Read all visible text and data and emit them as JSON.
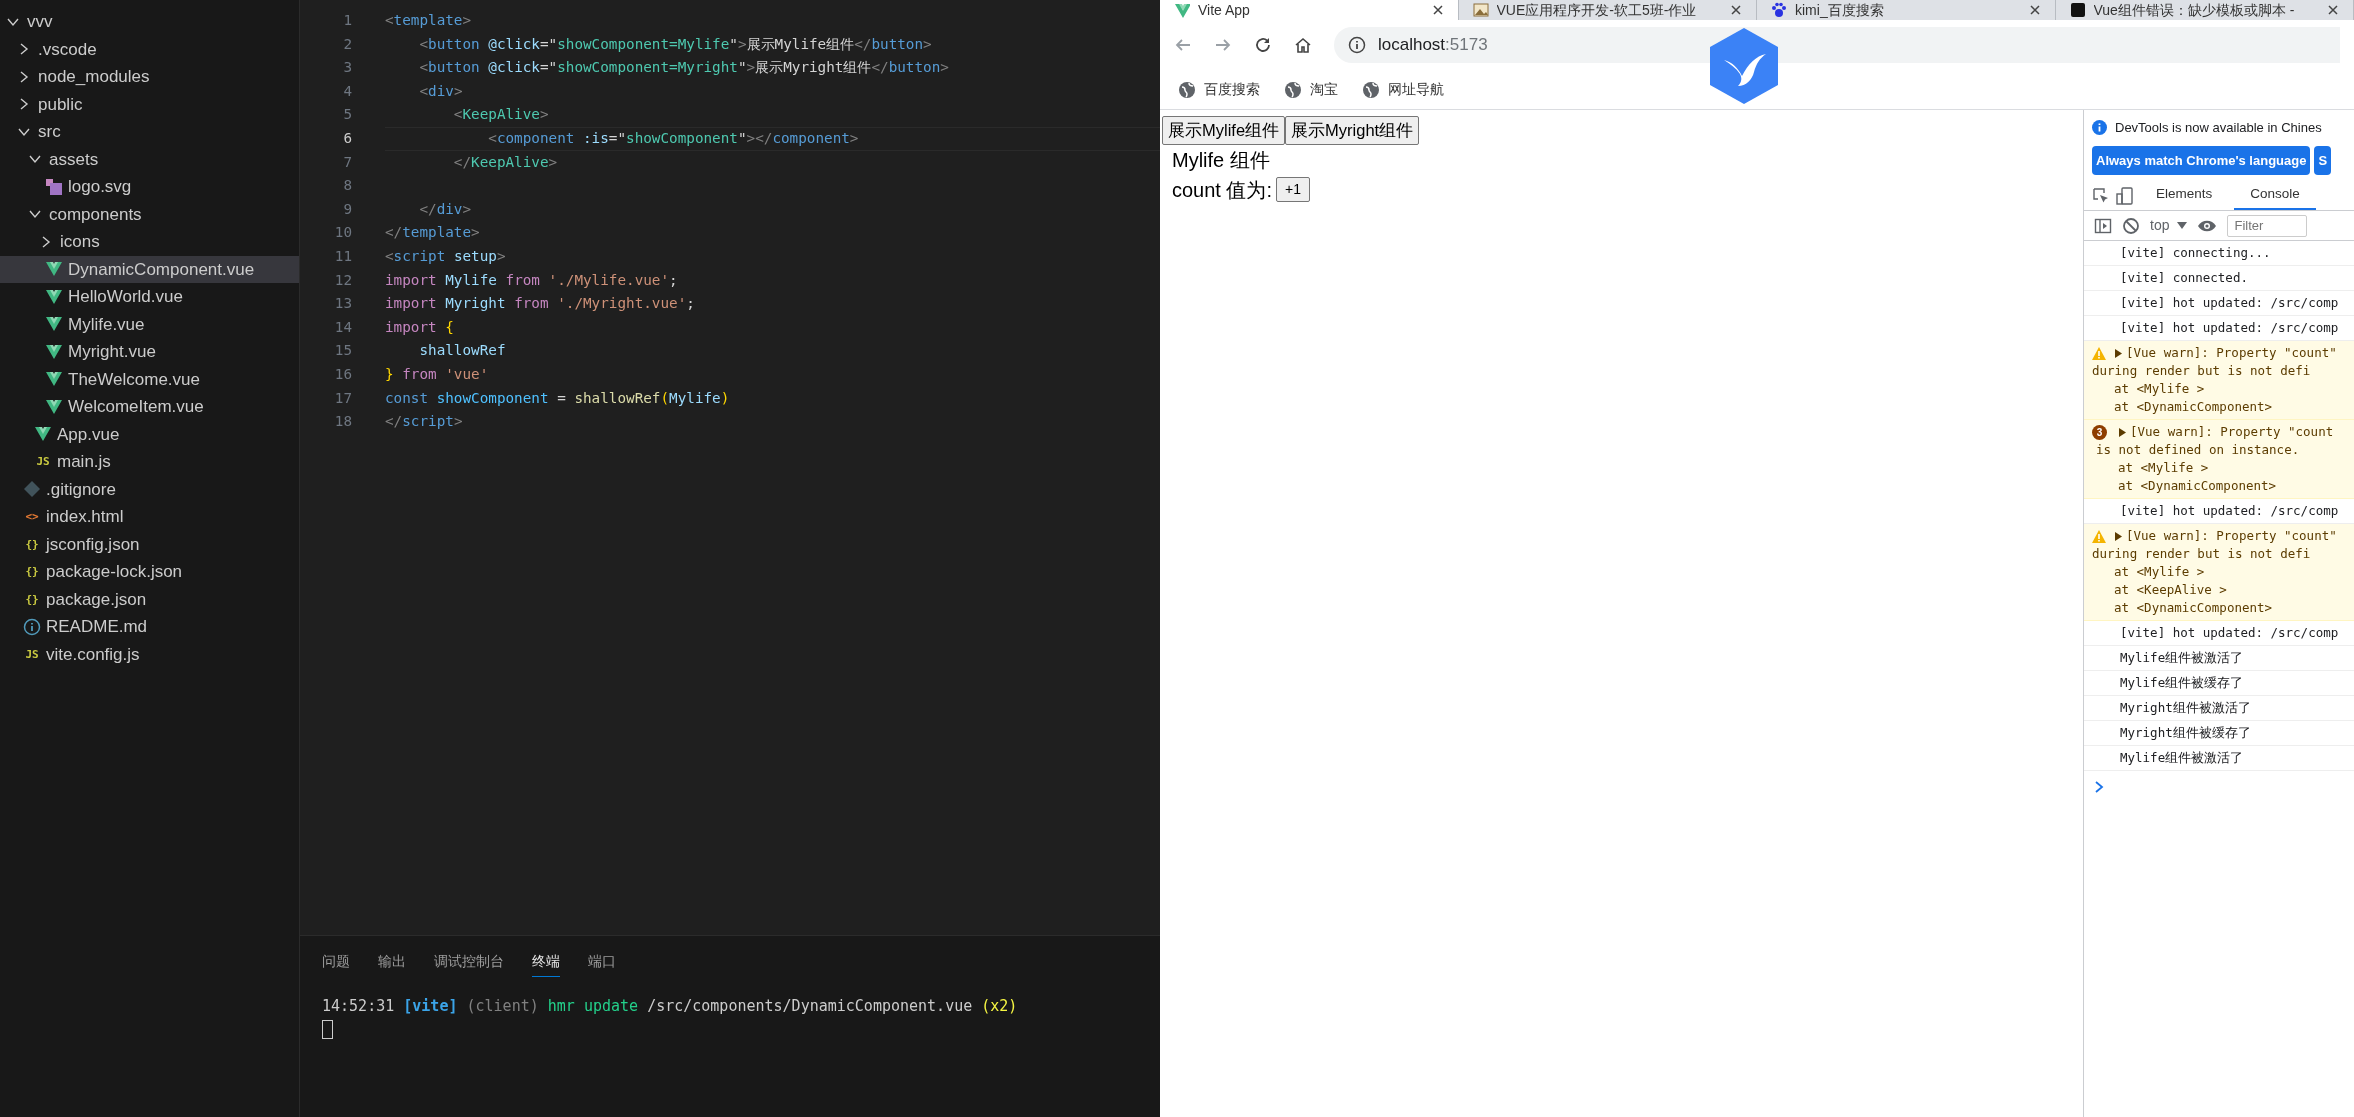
{
  "explorer": {
    "items": [
      {
        "label": "vvv",
        "kind": "folder",
        "expanded": true,
        "selected": false,
        "children": [
          {
            "label": ".vscode",
            "kind": "folder",
            "expanded": false,
            "selected": false
          },
          {
            "label": "node_modules",
            "kind": "folder",
            "expanded": false,
            "selected": false
          },
          {
            "label": "public",
            "kind": "folder",
            "expanded": false,
            "selected": false
          },
          {
            "label": "src",
            "kind": "folder",
            "expanded": true,
            "selected": false,
            "children": [
              {
                "label": "assets",
                "kind": "folder",
                "expanded": true,
                "selected": false,
                "children": [
                  {
                    "label": "logo.svg",
                    "kind": "svg",
                    "selected": false
                  }
                ]
              },
              {
                "label": "components",
                "kind": "folder",
                "expanded": true,
                "selected": false,
                "children": [
                  {
                    "label": "icons",
                    "kind": "folder",
                    "expanded": false,
                    "selected": false
                  },
                  {
                    "label": "DynamicComponent.vue",
                    "kind": "vue",
                    "selected": true
                  },
                  {
                    "label": "HelloWorld.vue",
                    "kind": "vue",
                    "selected": false
                  },
                  {
                    "label": "Mylife.vue",
                    "kind": "vue",
                    "selected": false
                  },
                  {
                    "label": "Myright.vue",
                    "kind": "vue",
                    "selected": false
                  },
                  {
                    "label": "TheWelcome.vue",
                    "kind": "vue",
                    "selected": false
                  },
                  {
                    "label": "WelcomeItem.vue",
                    "kind": "vue",
                    "selected": false
                  }
                ]
              },
              {
                "label": "App.vue",
                "kind": "vue",
                "selected": false
              },
              {
                "label": "main.js",
                "kind": "js",
                "icon_text": "JS",
                "selected": false
              }
            ]
          },
          {
            "label": ".gitignore",
            "kind": "git",
            "selected": false
          },
          {
            "label": "index.html",
            "kind": "html",
            "icon_text": "<>",
            "selected": false
          },
          {
            "label": "jsconfig.json",
            "kind": "json",
            "icon_text": "{}",
            "selected": false
          },
          {
            "label": "package-lock.json",
            "kind": "json",
            "icon_text": "{}",
            "selected": false
          },
          {
            "label": "package.json",
            "kind": "json",
            "icon_text": "{}",
            "selected": false
          },
          {
            "label": "README.md",
            "kind": "info",
            "selected": false
          },
          {
            "label": "vite.config.js",
            "kind": "js",
            "icon_text": "JS",
            "selected": false
          }
        ]
      }
    ]
  },
  "editor": {
    "lines": [
      {
        "number": "1",
        "current": false,
        "tokens": [
          {
            "kind": "punct",
            "text": "<"
          },
          {
            "kind": "tag",
            "text": "template"
          },
          {
            "kind": "punct",
            "text": ">"
          }
        ]
      },
      {
        "number": "2",
        "current": false,
        "tokens": [
          {
            "kind": "punct",
            "text": "    <"
          },
          {
            "kind": "tag",
            "text": "button "
          },
          {
            "kind": "attr",
            "text": "@click"
          },
          {
            "kind": "text",
            "text": "=\""
          },
          {
            "kind": "expr",
            "text": "showComponent=Mylife"
          },
          {
            "kind": "text",
            "text": "\""
          },
          {
            "kind": "punct",
            "text": ">"
          },
          {
            "kind": "text",
            "text": "展示Mylife组件"
          },
          {
            "kind": "punct",
            "text": "</"
          },
          {
            "kind": "tag",
            "text": "button"
          },
          {
            "kind": "punct",
            "text": ">"
          }
        ]
      },
      {
        "number": "3",
        "current": false,
        "tokens": [
          {
            "kind": "punct",
            "text": "    <"
          },
          {
            "kind": "tag",
            "text": "button "
          },
          {
            "kind": "attr",
            "text": "@click"
          },
          {
            "kind": "text",
            "text": "=\""
          },
          {
            "kind": "expr",
            "text": "showComponent=Myright"
          },
          {
            "kind": "text",
            "text": "\""
          },
          {
            "kind": "punct",
            "text": ">"
          },
          {
            "kind": "text",
            "text": "展示Myright组件"
          },
          {
            "kind": "punct",
            "text": "</"
          },
          {
            "kind": "tag",
            "text": "button"
          },
          {
            "kind": "punct",
            "text": ">"
          }
        ]
      },
      {
        "number": "4",
        "current": false,
        "tokens": [
          {
            "kind": "punct",
            "text": "    <"
          },
          {
            "kind": "tag",
            "text": "div"
          },
          {
            "kind": "punct",
            "text": ">"
          }
        ]
      },
      {
        "number": "5",
        "current": false,
        "tokens": [
          {
            "kind": "punct",
            "text": "        <"
          },
          {
            "kind": "comp",
            "text": "KeepAlive"
          },
          {
            "kind": "punct",
            "text": ">"
          }
        ]
      },
      {
        "number": "6",
        "current": true,
        "tokens": [
          {
            "kind": "punct",
            "text": "            <"
          },
          {
            "kind": "tag",
            "text": "component "
          },
          {
            "kind": "attr",
            "text": ":is"
          },
          {
            "kind": "text",
            "text": "=\""
          },
          {
            "kind": "expr",
            "text": "showComponent"
          },
          {
            "kind": "text",
            "text": "\""
          },
          {
            "kind": "punct",
            "text": "></"
          },
          {
            "kind": "tag",
            "text": "component"
          },
          {
            "kind": "punct",
            "text": ">"
          }
        ]
      },
      {
        "number": "7",
        "current": false,
        "tokens": [
          {
            "kind": "punct",
            "text": "        </"
          },
          {
            "kind": "comp",
            "text": "KeepAlive"
          },
          {
            "kind": "punct",
            "text": ">"
          }
        ]
      },
      {
        "number": "8",
        "current": false
      },
      {
        "number": "9",
        "current": false,
        "tokens": [
          {
            "kind": "punct",
            "text": "    </"
          },
          {
            "kind": "tag",
            "text": "div"
          },
          {
            "kind": "punct",
            "text": ">"
          }
        ]
      },
      {
        "number": "10",
        "current": false,
        "tokens": [
          {
            "kind": "punct",
            "text": "</"
          },
          {
            "kind": "tag",
            "text": "template"
          },
          {
            "kind": "punct",
            "text": ">"
          }
        ]
      },
      {
        "number": "11",
        "current": false,
        "tokens": [
          {
            "kind": "punct",
            "text": "<"
          },
          {
            "kind": "tag",
            "text": "script "
          },
          {
            "kind": "attr",
            "text": "setup"
          },
          {
            "kind": "punct",
            "text": ">"
          }
        ]
      },
      {
        "number": "12",
        "current": false,
        "tokens": [
          {
            "kind": "keyword",
            "text": "import "
          },
          {
            "kind": "var",
            "text": "Mylife "
          },
          {
            "kind": "keyword",
            "text": "from "
          },
          {
            "kind": "string",
            "text": "'./Mylife.vue'"
          },
          {
            "kind": "text",
            "text": ";"
          }
        ]
      },
      {
        "number": "13",
        "current": false,
        "tokens": [
          {
            "kind": "keyword",
            "text": "import "
          },
          {
            "kind": "var",
            "text": "Myright "
          },
          {
            "kind": "keyword",
            "text": "from "
          },
          {
            "kind": "string",
            "text": "'./Myright.vue'"
          },
          {
            "kind": "text",
            "text": ";"
          }
        ]
      },
      {
        "number": "14",
        "current": false,
        "tokens": [
          {
            "kind": "keyword",
            "text": "import "
          },
          {
            "kind": "brace",
            "text": "{"
          }
        ]
      },
      {
        "number": "15",
        "current": false,
        "tokens": [
          {
            "kind": "var",
            "text": "    shallowRef"
          }
        ]
      },
      {
        "number": "16",
        "current": false,
        "tokens": [
          {
            "kind": "brace",
            "text": "} "
          },
          {
            "kind": "keyword",
            "text": "from "
          },
          {
            "kind": "string",
            "text": "'vue'"
          }
        ]
      },
      {
        "number": "17",
        "current": false,
        "tokens": [
          {
            "kind": "const",
            "text": "const "
          },
          {
            "kind": "cvar",
            "text": "showComponent"
          },
          {
            "kind": "text",
            "text": " = "
          },
          {
            "kind": "fn",
            "text": "shallowRef"
          },
          {
            "kind": "brace",
            "text": "("
          },
          {
            "kind": "var",
            "text": "Mylife"
          },
          {
            "kind": "brace",
            "text": ")"
          }
        ]
      },
      {
        "number": "18",
        "current": false,
        "tokens": [
          {
            "kind": "punct",
            "text": "</"
          },
          {
            "kind": "tag",
            "text": "script"
          },
          {
            "kind": "punct",
            "text": ">"
          }
        ]
      }
    ]
  },
  "panel": {
    "tabs": [
      {
        "label": "问题",
        "selected": false
      },
      {
        "label": "输出",
        "selected": false
      },
      {
        "label": "调试控制台",
        "selected": false
      },
      {
        "label": "终端",
        "selected": true
      },
      {
        "label": "端口",
        "selected": false
      }
    ],
    "terminal": {
      "tokens": [
        {
          "kind": "time",
          "text": "14:52:31 "
        },
        {
          "kind": "vite",
          "text": "[vite] "
        },
        {
          "kind": "dim",
          "text": "(client) "
        },
        {
          "kind": "green",
          "text": "hmr update "
        },
        {
          "kind": "time",
          "text": "/src/components/DynamicComponent.vue "
        },
        {
          "kind": "yellow",
          "text": "(x2)"
        }
      ]
    }
  },
  "browser": {
    "tabs": [
      {
        "title": "Vite App",
        "kind": "vue",
        "selected": true
      },
      {
        "title": "VUE应用程序开发-软工5班-作业",
        "kind": "image",
        "selected": false
      },
      {
        "title": "kimi_百度搜索",
        "kind": "paw",
        "selected": false
      },
      {
        "title": "Vue组件错误：缺少模板或脚本 -",
        "kind": "dark",
        "selected": false
      }
    ],
    "address": {
      "host": "localhost",
      "port": ":5173"
    },
    "bookmarks": [
      {
        "label": "百度搜索"
      },
      {
        "label": "淘宝"
      },
      {
        "label": "网址导航"
      }
    ],
    "page": {
      "buttons": [
        "展示Mylife组件",
        "展示Myright组件"
      ],
      "heading": "Mylife 组件",
      "count_label": "count 值为:",
      "count_button": "+1"
    }
  },
  "devtools": {
    "notice": {
      "text": "DevTools is now available in Chines",
      "buttons": [
        "Always match Chrome's language",
        "S"
      ]
    },
    "tabs": [
      {
        "label": "Elements",
        "selected": false
      },
      {
        "label": "Console",
        "selected": true
      }
    ],
    "console": {
      "context": "top",
      "filter_placeholder": "Filter",
      "messages": [
        {
          "kind": "log",
          "text": "[vite] connecting..."
        },
        {
          "kind": "log",
          "text": "[vite] connected."
        },
        {
          "kind": "log",
          "text": "[vite] hot updated: /src/comp"
        },
        {
          "kind": "log",
          "text": "[vite] hot updated: /src/comp"
        },
        {
          "kind": "warn",
          "lines": [
            {
              "kind": "head",
              "text": "[Vue warn]: Property \"count\""
            },
            {
              "kind": "text",
              "text": "during render but is not defi"
            },
            {
              "kind": "frame",
              "text": "at <Mylife >"
            },
            {
              "kind": "frame",
              "text": "at <DynamicComponent>"
            }
          ]
        },
        {
          "kind": "warn",
          "count": "3",
          "lines": [
            {
              "kind": "head",
              "text": "[Vue warn]: Property \"count"
            },
            {
              "kind": "text",
              "text": "is not defined on instance."
            },
            {
              "kind": "frame",
              "text": "at <Mylife >"
            },
            {
              "kind": "frame",
              "text": "at <DynamicComponent>"
            }
          ]
        },
        {
          "kind": "log",
          "text": "[vite] hot updated: /src/comp"
        },
        {
          "kind": "warn",
          "lines": [
            {
              "kind": "head",
              "text": "[Vue warn]: Property \"count\""
            },
            {
              "kind": "text",
              "text": "during render but is not defi"
            },
            {
              "kind": "frame",
              "text": "at <Mylife >"
            },
            {
              "kind": "frame",
              "text": "at <KeepAlive >"
            },
            {
              "kind": "frame",
              "text": "at <DynamicComponent>"
            }
          ]
        },
        {
          "kind": "log",
          "text": "[vite] hot updated: /src/comp"
        },
        {
          "kind": "log",
          "text": "Mylife组件被激活了"
        },
        {
          "kind": "log",
          "text": "Mylife组件被缓存了"
        },
        {
          "kind": "log",
          "text": "Myright组件被激活了"
        },
        {
          "kind": "log",
          "text": "Myright组件被缓存了"
        },
        {
          "kind": "log",
          "text": "Mylife组件被激活了"
        }
      ]
    }
  }
}
